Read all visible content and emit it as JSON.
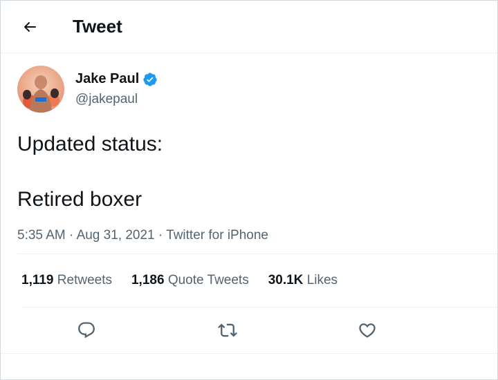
{
  "header": {
    "title": "Tweet",
    "back_icon": "arrow-left-icon"
  },
  "author": {
    "name": "Jake Paul",
    "handle": "@jakepaul",
    "verified_icon": "verified-badge-icon",
    "verified_color": "#1d9bf0"
  },
  "tweet": {
    "line1": "Updated status:",
    "line2": "Retired boxer"
  },
  "meta": {
    "time": "5:35 AM",
    "separator1": " · ",
    "date": "Aug 31, 2021",
    "separator2": " · ",
    "source": "Twitter for iPhone"
  },
  "stats": {
    "retweets_count": "1,119",
    "retweets_label": "Retweets",
    "quotes_count": "1,186",
    "quotes_label": "Quote Tweets",
    "likes_count": "30.1K",
    "likes_label": "Likes"
  },
  "actions": {
    "reply_icon": "reply-icon",
    "retweet_icon": "retweet-icon",
    "like_icon": "like-heart-icon"
  },
  "colors": {
    "text": "#0f1419",
    "secondary": "#536471",
    "divider": "#eff3f4",
    "accent": "#1d9bf0"
  }
}
